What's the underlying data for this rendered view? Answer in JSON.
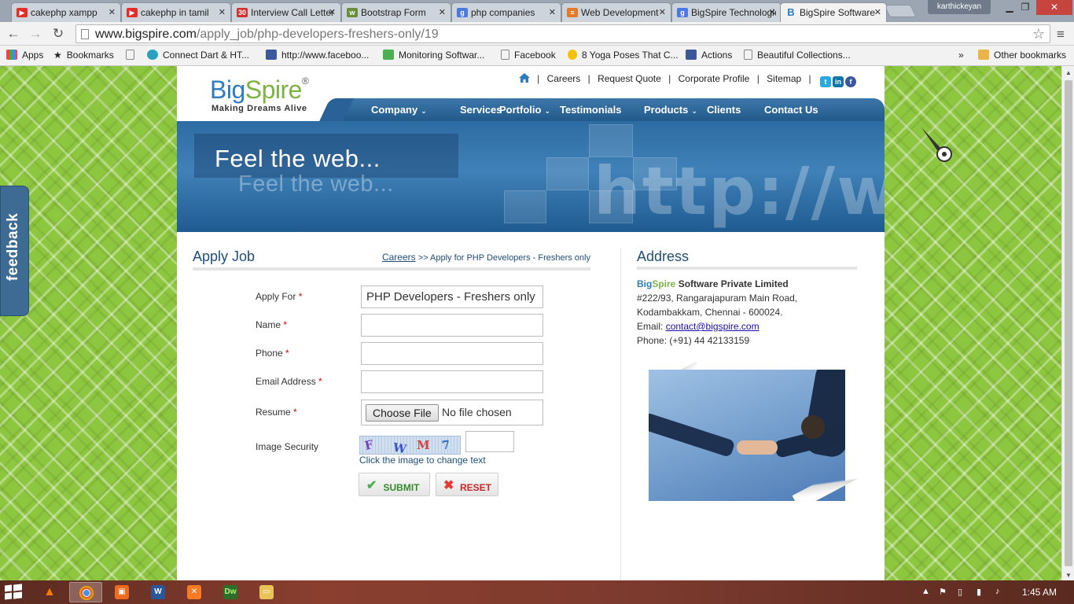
{
  "browser": {
    "tabs": [
      {
        "title": "cakephp xampp",
        "favicon": "youtube-icon",
        "color": "#e52d27"
      },
      {
        "title": "cakephp in tamil",
        "favicon": "youtube-icon",
        "color": "#e52d27"
      },
      {
        "title": "Interview Call Letter",
        "favicon": "badge-icon",
        "color": "#d32f2f"
      },
      {
        "title": "Bootstrap Form",
        "favicon": "w3-icon",
        "color": "#6a8f3a"
      },
      {
        "title": "php companies",
        "favicon": "google-icon",
        "color": "#4a7ae0"
      },
      {
        "title": "Web Development",
        "favicon": "site-icon",
        "color": "#e07b2b"
      },
      {
        "title": "BigSpire Technologies",
        "favicon": "google-icon",
        "color": "#4a7ae0"
      },
      {
        "title": "BigSpire Software",
        "favicon": "bigspire-icon",
        "color": "#2b7cc0",
        "active": true
      }
    ],
    "user": "karthickeyan",
    "url_host": "www.bigspire.com",
    "url_path": "/apply_job/php-developers-freshers-only/19",
    "bookmarks": [
      {
        "label": "Apps",
        "icon": "apps-grid-icon"
      },
      {
        "label": "Bookmarks",
        "icon": "star-icon"
      },
      {
        "label": "",
        "icon": "page-icon"
      },
      {
        "label": "Connect Dart & HT...",
        "icon": "dart-icon"
      },
      {
        "label": "http://www.faceboo...",
        "icon": "facebook-icon"
      },
      {
        "label": "Monitoring Softwar...",
        "icon": "check-icon"
      },
      {
        "label": "Facebook",
        "icon": "page-icon"
      },
      {
        "label": "8 Yoga Poses That C...",
        "icon": "pin-icon"
      },
      {
        "label": "Actions",
        "icon": "facebook-icon"
      },
      {
        "label": "Beautiful Collections...",
        "icon": "page-icon"
      },
      {
        "label": "»",
        "icon": ""
      },
      {
        "label": "Other bookmarks",
        "icon": "folder-icon"
      }
    ]
  },
  "site": {
    "logo": {
      "big": "Big",
      "spire": "Spire",
      "reg": "®",
      "tagline": "Making Dreams Alive"
    },
    "top_links": [
      "Careers",
      "Request Quote",
      "Corporate Profile",
      "Sitemap"
    ],
    "nav": [
      {
        "label": "Company",
        "dropdown": true
      },
      {
        "label": "Services",
        "dropdown": true
      },
      {
        "label": "Portfolio",
        "dropdown": true
      },
      {
        "label": "Testimonials",
        "dropdown": false
      },
      {
        "label": "Products",
        "dropdown": true
      },
      {
        "label": "Clients",
        "dropdown": false
      },
      {
        "label": "Contact Us",
        "dropdown": false
      }
    ],
    "banner": {
      "title": "Feel the web...",
      "echo": "Feel the web...",
      "url_art": "http://www"
    },
    "feedback_label": "feedback"
  },
  "apply": {
    "title": "Apply Job",
    "breadcrumb_link": "Careers",
    "breadcrumb_rest": ">> Apply for PHP Developers - Freshers only",
    "fields": {
      "apply_for": {
        "label": "Apply For",
        "value": "PHP Developers - Freshers only"
      },
      "name": {
        "label": "Name",
        "value": ""
      },
      "phone": {
        "label": "Phone",
        "value": ""
      },
      "email": {
        "label": "Email Address",
        "value": ""
      },
      "resume": {
        "label": "Resume",
        "button": "Choose File",
        "status": "No file chosen"
      },
      "security": {
        "label": "Image Security",
        "captcha_chars": [
          "F",
          "W",
          "M",
          "7"
        ],
        "hint": "Click the image to change text"
      }
    },
    "required_mark": "*",
    "submit_label": "SUBMIT",
    "reset_label": "RESET"
  },
  "address": {
    "title": "Address",
    "company_big": "Big",
    "company_spire": "Spire",
    "company_rest": " Software Private Limited",
    "line1": "#222/93, Rangarajapuram Main Road,",
    "line2": "Kodambakkam, Chennai - 600024.",
    "email_label": "Email: ",
    "email": "contact@bigspire.com",
    "phone": "Phone: (+91) 44 42133159"
  },
  "taskbar": {
    "time": "1:45 AM",
    "apps": [
      "vlc-icon",
      "chrome-icon",
      "xampp-files-icon",
      "word-icon",
      "xampp-icon",
      "dreamweaver-icon",
      "explorer-icon"
    ]
  }
}
